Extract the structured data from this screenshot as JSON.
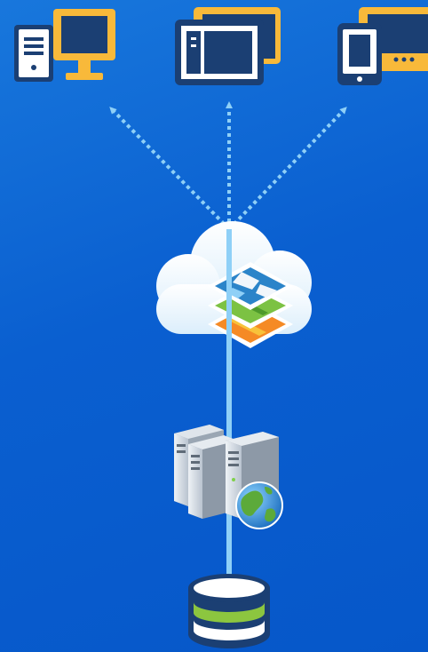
{
  "diagram": {
    "nodes": [
      {
        "id": "desktop",
        "icon": "desktop-computer-icon"
      },
      {
        "id": "tablet",
        "icon": "tablet-icon"
      },
      {
        "id": "phone",
        "icon": "phone-icon"
      },
      {
        "id": "cloud",
        "icon": "cloud-map-layers-icon"
      },
      {
        "id": "servers",
        "icon": "web-servers-globe-icon"
      },
      {
        "id": "database",
        "icon": "database-icon"
      }
    ],
    "links": [
      {
        "from": "database",
        "to": "cloud",
        "style": "solid"
      },
      {
        "from": "cloud",
        "to": "desktop",
        "style": "dotted-arrow"
      },
      {
        "from": "cloud",
        "to": "tablet",
        "style": "dotted-arrow"
      },
      {
        "from": "cloud",
        "to": "phone",
        "style": "dotted-arrow"
      }
    ]
  },
  "colors": {
    "background_top": "#1877dc",
    "background_bottom": "#0657c9",
    "device_orange": "#f8b93a",
    "device_navy": "#1b3f73",
    "connector_light_blue": "#8fd0f7",
    "cloud_white": "#ffffff",
    "layer_green": "#7cc243",
    "layer_orange": "#f58a25",
    "database_green": "#8cc63f"
  }
}
